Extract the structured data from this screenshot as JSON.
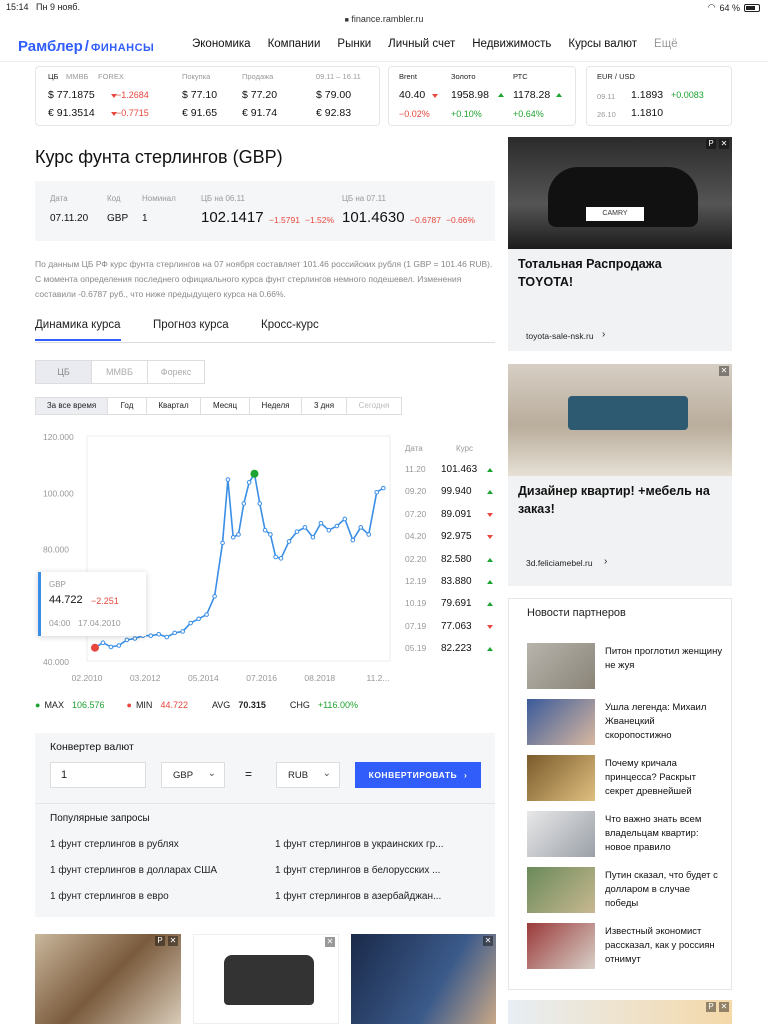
{
  "status": {
    "time": "15:14",
    "date": "Пн 9 нояб.",
    "battery": "64 %"
  },
  "url": "finance.rambler.ru",
  "logo": {
    "name": "Рамблер",
    "slash": "/",
    "section": "ФИНАНСЫ"
  },
  "menu": [
    "Экономика",
    "Компании",
    "Рынки",
    "Личный счет",
    "Недвижимость",
    "Курсы валют",
    "Ещё"
  ],
  "ticker1": {
    "tabs": [
      "ЦБ",
      "ММВБ",
      "FOREX"
    ],
    "col_buy": "Покупка",
    "col_sell": "Продажа",
    "col_range": "09.11 – 16.11",
    "rows": [
      {
        "val": "$ 77.1875",
        "chg": "−1.2684",
        "buy": "$ 77.10",
        "sell": "$ 77.20",
        "fut": "$ 79.00"
      },
      {
        "val": "€ 91.3514",
        "chg": "−0.7715",
        "buy": "€ 91.65",
        "sell": "€ 91.74",
        "fut": "€ 92.83"
      }
    ]
  },
  "ticker2": {
    "items": [
      {
        "name": "Brent",
        "val": "40.40",
        "chg": "−0.02%"
      },
      {
        "name": "Золото",
        "val": "1958.98",
        "chg": "+0.10%"
      },
      {
        "name": "РТС",
        "val": "1178.28",
        "chg": "+0.64%"
      }
    ]
  },
  "ticker3": {
    "name": "EUR / USD",
    "rows": [
      {
        "d": "09.11",
        "v": "1.1893",
        "c": "+0.0083"
      },
      {
        "d": "26.10",
        "v": "1.1810",
        "c": ""
      }
    ]
  },
  "page_title": "Курс фунта стерлингов (GBP)",
  "info": {
    "h_date": "Дата",
    "h_code": "Код",
    "h_nom": "Номинал",
    "h_cb1": "ЦБ на 06.11",
    "h_cb2": "ЦБ на 07.11",
    "date": "07.11.20",
    "code": "GBP",
    "nom": "1",
    "cb1": "102.1417",
    "cb1_chg": "−1.5791",
    "cb1_pct": "−1.52%",
    "cb2": "101.4630",
    "cb2_chg": "−0.6787",
    "cb2_pct": "−0.66%"
  },
  "description": "По данным ЦБ РФ курс фунта стерлингов на 07 ноября составляет 101.46 российских рубля (1 GBP = 101.46 RUB). С момента определения последнего официального курса фунт стерлингов немного подешевел. Изменения составили -0.6787 руб., что ниже предыдущего курса на 0.66%.",
  "tabs": [
    "Динамика курса",
    "Прогноз курса",
    "Кросс-курс"
  ],
  "sources": [
    "ЦБ",
    "ММВБ",
    "Форекс"
  ],
  "periods": [
    "За все время",
    "Год",
    "Квартал",
    "Месяц",
    "Неделя",
    "3 дня",
    "Сегодня"
  ],
  "chart_data": {
    "type": "line",
    "ylim": [
      40000,
      120000
    ],
    "yticks": [
      "120.000",
      "100.000",
      "80.000",
      "60.000",
      "40.000"
    ],
    "xticks": [
      "02.2010",
      "03.2012",
      "05.2014",
      "07.2016",
      "08.2018",
      "11.2..."
    ],
    "x": [
      2010.0,
      2010.3,
      2010.6,
      2010.9,
      2011.2,
      2011.5,
      2011.8,
      2012.1,
      2012.4,
      2012.7,
      2013.0,
      2013.3,
      2013.6,
      2013.9,
      2014.2,
      2014.5,
      2014.8,
      2015.0,
      2015.2,
      2015.4,
      2015.6,
      2015.8,
      2016.0,
      2016.2,
      2016.4,
      2016.6,
      2016.8,
      2017.0,
      2017.3,
      2017.6,
      2017.9,
      2018.2,
      2018.5,
      2018.8,
      2019.1,
      2019.4,
      2019.7,
      2020.0,
      2020.3,
      2020.6,
      2020.85
    ],
    "values": [
      44722,
      46500,
      45000,
      45500,
      47500,
      48000,
      49000,
      49000,
      49500,
      48500,
      50000,
      50500,
      53500,
      55000,
      56500,
      63000,
      82000,
      104500,
      84000,
      85000,
      96000,
      103500,
      106576,
      96000,
      86500,
      85000,
      77000,
      76500,
      82500,
      86000,
      87500,
      84000,
      89000,
      86500,
      88000,
      90500,
      83000,
      87500,
      85000,
      100000,
      101463
    ],
    "max_point": {
      "x": 2016.0,
      "y": 106576
    },
    "min_point": {
      "x": 2010.0,
      "y": 44722
    }
  },
  "rate_table": {
    "h_date": "Дата",
    "h_rate": "Курс",
    "rows": [
      {
        "d": "11.20",
        "v": "101.463",
        "up": true
      },
      {
        "d": "09.20",
        "v": "99.940",
        "up": true
      },
      {
        "d": "07.20",
        "v": "89.091",
        "up": false
      },
      {
        "d": "04.20",
        "v": "92.975",
        "up": false
      },
      {
        "d": "02.20",
        "v": "82.580",
        "up": true
      },
      {
        "d": "12.19",
        "v": "83.880",
        "up": true
      },
      {
        "d": "10.19",
        "v": "79.691",
        "up": true
      },
      {
        "d": "07.19",
        "v": "77.063",
        "up": false
      },
      {
        "d": "05.19",
        "v": "82.223",
        "up": true
      }
    ]
  },
  "tooltip": {
    "code": "GBP",
    "val": "44.722",
    "chg": "−2.251",
    "time": "04:00",
    "date": "17.04.2010"
  },
  "stats": {
    "max_l": "MAX",
    "max": "106.576",
    "min_l": "MIN",
    "min": "44.722",
    "avg_l": "AVG",
    "avg": "70.315",
    "chg_l": "CHG",
    "chg": "+116.00%"
  },
  "converter": {
    "title": "Конвертер валют",
    "amount": "1",
    "from": "GBP",
    "eq": "=",
    "to": "RUB",
    "button": "КОНВЕРТИРОВАТЬ"
  },
  "popular": {
    "title": "Популярные запросы",
    "items": [
      "1 фунт стерлингов в рублях",
      "1 фунт стерлингов в украинских гр...",
      "1 фунт стерлингов в долларах США",
      "1 фунт стерлингов в белорусских ...",
      "1 фунт стерлингов в евро",
      "1 фунт стерлингов в азербайджан..."
    ]
  },
  "ad1": {
    "title": "Тотальная Распродажа TOYOTA!",
    "src": "toyota-sale-nsk.ru",
    "plate": "CAMRY"
  },
  "ad2": {
    "title": "Дизайнер квартир! +мебель на заказ!",
    "src": "3d.feliciamebel.ru"
  },
  "partners": {
    "title": "Новости партнеров",
    "items": [
      "Питон проглотил женщину не жуя",
      "Ушла легенда: Михаил Жванецкий скоропостижно",
      "Почему кричала принцесса? Раскрыт секрет древнейшей",
      "Что важно знать всем владельцам квартир: новое правило",
      "Путин сказал, что будет с долларом в случае победы",
      "Известный экономист рассказал, как у россиян отнимут"
    ]
  },
  "adlabel": "Р",
  "close": "✕"
}
